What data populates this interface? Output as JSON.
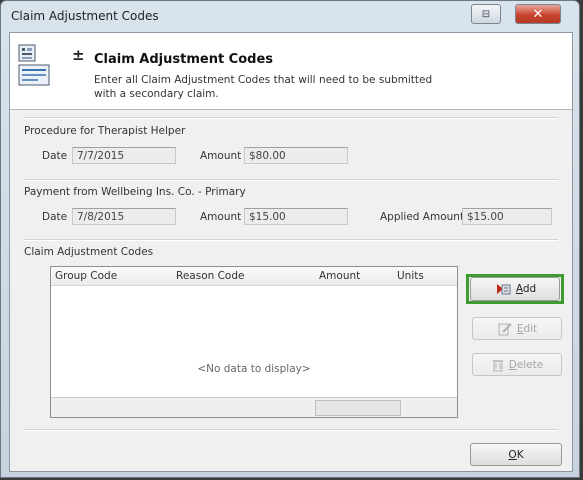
{
  "window": {
    "title": "Claim Adjustment Codes",
    "help_glyph": "⊟",
    "close_glyph": "✕"
  },
  "header": {
    "plus_glyph": "±",
    "title": "Claim Adjustment Codes",
    "description": "Enter all Claim Adjustment Codes that will need to be submitted with a secondary claim."
  },
  "procedure": {
    "section_label": "Procedure for Therapist Helper",
    "date_label": "Date",
    "date_value": "7/7/2015",
    "amount_label": "Amount",
    "amount_value": "$80.00"
  },
  "payment": {
    "section_label": "Payment from Wellbeing Ins. Co. - Primary",
    "date_label": "Date",
    "date_value": "7/8/2015",
    "amount_label": "Amount",
    "amount_value": "$15.00",
    "applied_label": "Applied Amount",
    "applied_value": "$15.00"
  },
  "codes": {
    "section_label": "Claim Adjustment Codes",
    "columns": [
      "Group Code",
      "Reason Code",
      "Amount",
      "Units"
    ],
    "empty_message": "<No data to display>"
  },
  "buttons": {
    "add": {
      "prefix": "",
      "underlined": "A",
      "suffix": "dd"
    },
    "edit": {
      "prefix": "",
      "underlined": "E",
      "suffix": "dit"
    },
    "delete": {
      "prefix": "",
      "underlined": "D",
      "suffix": "elete"
    },
    "ok": {
      "prefix": "",
      "underlined": "O",
      "suffix": "K"
    }
  },
  "colors": {
    "add_highlight": "#3e9b2f",
    "close_button": "#c8442e"
  }
}
